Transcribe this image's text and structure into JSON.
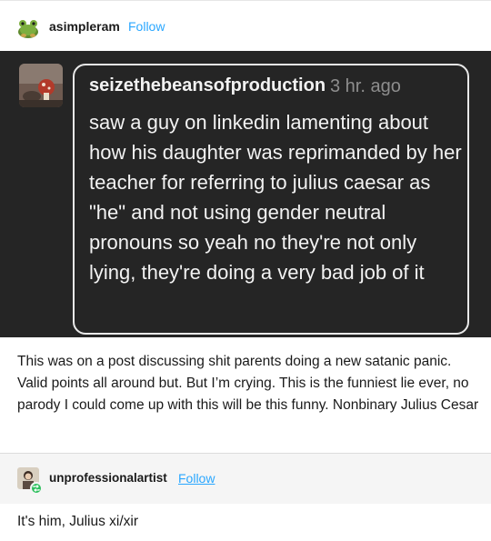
{
  "post": {
    "author": "asimpleram",
    "follow_label": "Follow"
  },
  "quoted": {
    "username": "seizethebeansofproduction",
    "time": "3 hr. ago",
    "text": "saw a guy on linkedin lamenting about how his daughter was reprimanded by her teacher for referring to julius caesar as \"he\" and not using gender neutral pronouns so yeah no they're not only lying, they're doing a very bad job of it"
  },
  "caption": "This was on a post discussing shit parents doing a new satanic panic. Valid points all around but. But I’m crying. This is the funniest lie ever, no parody I could come up with this will be this funny. Nonbinary Julius Cesar",
  "reblog": {
    "author": "unprofessionalartist",
    "follow_label": "Follow",
    "text": "It's him, Julius xi/xir"
  },
  "colors": {
    "follow": "#2aa7ff",
    "dark_bg": "#252525",
    "reblog_badge": "#2bbf5b"
  }
}
